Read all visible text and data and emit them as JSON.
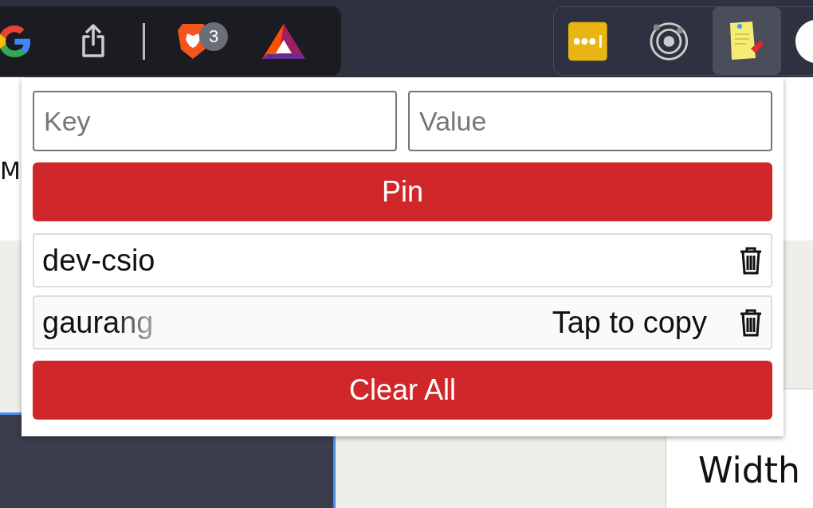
{
  "toolbar": {
    "badge": "3"
  },
  "page": {
    "heading_fragment": "M",
    "label": "Width"
  },
  "popup": {
    "key_field": {
      "placeholder": "Key"
    },
    "value_field": {
      "placeholder": "Value"
    },
    "pin_button": "Pin",
    "pins": [
      {
        "key": "dev-csio",
        "hovered": false
      },
      {
        "key": "gaurang",
        "hovered": true,
        "hint": "Tap to copy"
      }
    ],
    "clear_button": "Clear All"
  }
}
